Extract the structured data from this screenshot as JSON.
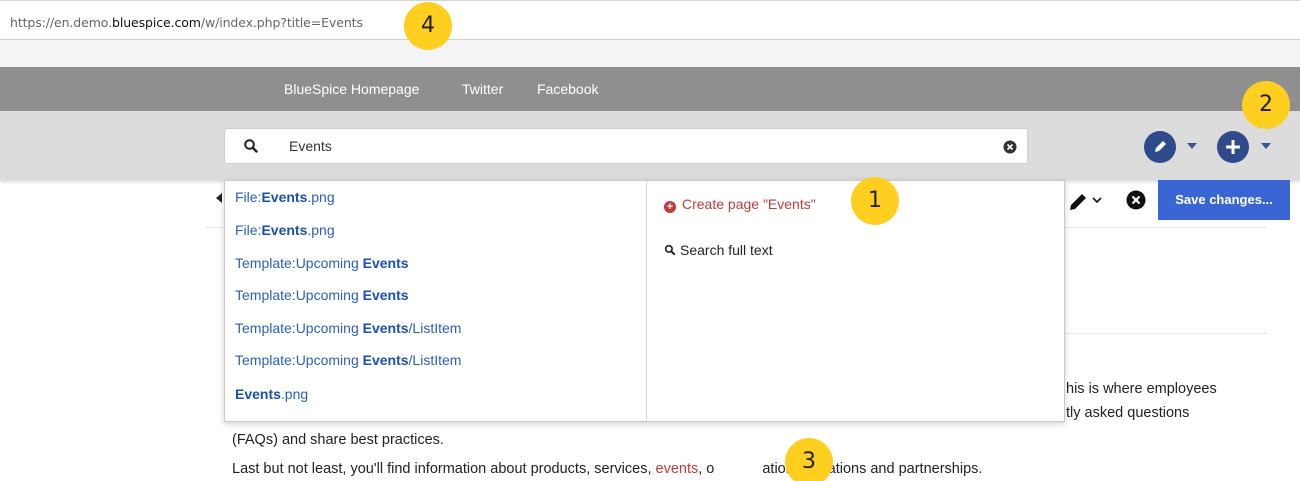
{
  "browser": {
    "url_prefix": "https://en.demo.",
    "url_host": "bluespice.com",
    "url_suffix": "/w/index.php?title=Events"
  },
  "topnav": {
    "links": [
      "BlueSpice Homepage",
      "Twitter",
      "Facebook"
    ]
  },
  "search": {
    "value": "Events"
  },
  "editor": {
    "save_label": "Save changes..."
  },
  "suggestions": [
    {
      "prefix": "File:",
      "match": "Events",
      "suffix": ".png"
    },
    {
      "prefix": "File:",
      "match": "Events",
      "suffix": ".png"
    },
    {
      "prefix": "Template:Upcoming ",
      "match": "Events",
      "suffix": ""
    },
    {
      "prefix": "Template:Upcoming ",
      "match": "Events",
      "suffix": ""
    },
    {
      "prefix": "Template:Upcoming ",
      "match": "Events",
      "suffix": "/ListItem"
    },
    {
      "prefix": "Template:Upcoming ",
      "match": "Events",
      "suffix": "/ListItem"
    },
    {
      "prefix": "",
      "match": "Events",
      "suffix": ".png"
    }
  ],
  "actions": {
    "create_page": "Create page \"Events\"",
    "search_full_text": "Search full text"
  },
  "content": {
    "frag1": "his is where employees",
    "frag2": "tly asked questions",
    "frag3": "(FAQs) and share best practices.",
    "frag4_a": "Last but not least, you'll find information about products, services, ",
    "frag4_link": "events",
    "frag4_b": ", o",
    "frag4_c": "ations, locations and partnerships."
  },
  "markers": [
    "1",
    "2",
    "3",
    "4"
  ],
  "colors": {
    "accent": "#3a66d4",
    "brand_button": "#2e4a8a",
    "marker": "#ffcf1f",
    "red_link": "#c23b3b"
  }
}
